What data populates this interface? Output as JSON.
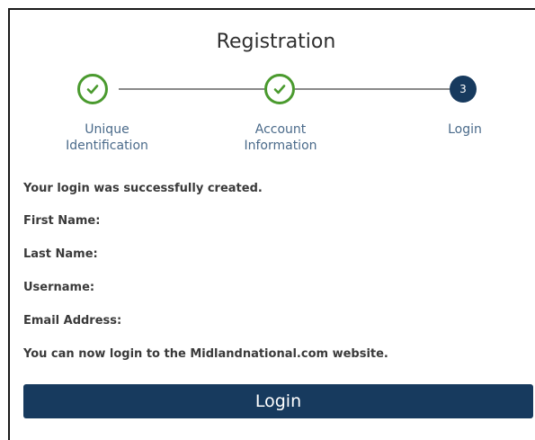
{
  "page": {
    "title": "Registration"
  },
  "stepper": {
    "steps": [
      {
        "label_line1": "Unique",
        "label_line2": "Identification",
        "status": "complete",
        "icon": "check-icon"
      },
      {
        "label_line1": "Account",
        "label_line2": "Information",
        "status": "complete",
        "icon": "check-icon"
      },
      {
        "label_line1": "Login",
        "label_line2": "",
        "status": "current",
        "number": "3"
      }
    ]
  },
  "content": {
    "success_message": "Your login was successfully created.",
    "first_name_label": "First Name:",
    "last_name_label": "Last Name:",
    "username_label": "Username:",
    "email_label": "Email Address:",
    "info_message": "You can now login to the Midlandnational.com website."
  },
  "actions": {
    "login_label": "Login"
  },
  "colors": {
    "primary": "#173a5e",
    "complete": "#4a9a2e",
    "step_label": "#4a6a8a"
  }
}
